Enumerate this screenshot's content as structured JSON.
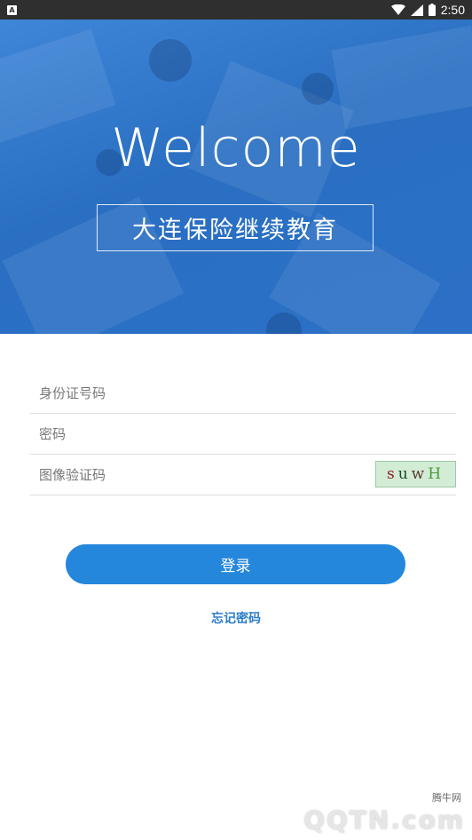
{
  "status_bar": {
    "notification_icon": "a-square-icon",
    "time": "2:50"
  },
  "banner": {
    "welcome": "Welcome",
    "subtitle": "大连保险继续教育"
  },
  "form": {
    "id_placeholder": "身份证号码",
    "password_placeholder": "密码",
    "captcha_placeholder": "图像验证码",
    "captcha_chars": [
      "s",
      "u",
      "w",
      "H"
    ]
  },
  "actions": {
    "login_label": "登录",
    "forgot_label": "忘记密码"
  },
  "watermark": {
    "site_name": "腾牛网",
    "logo_text": "QQTN.com"
  },
  "colors": {
    "accent": "#2587dc",
    "banner": "#2a6fc2"
  }
}
